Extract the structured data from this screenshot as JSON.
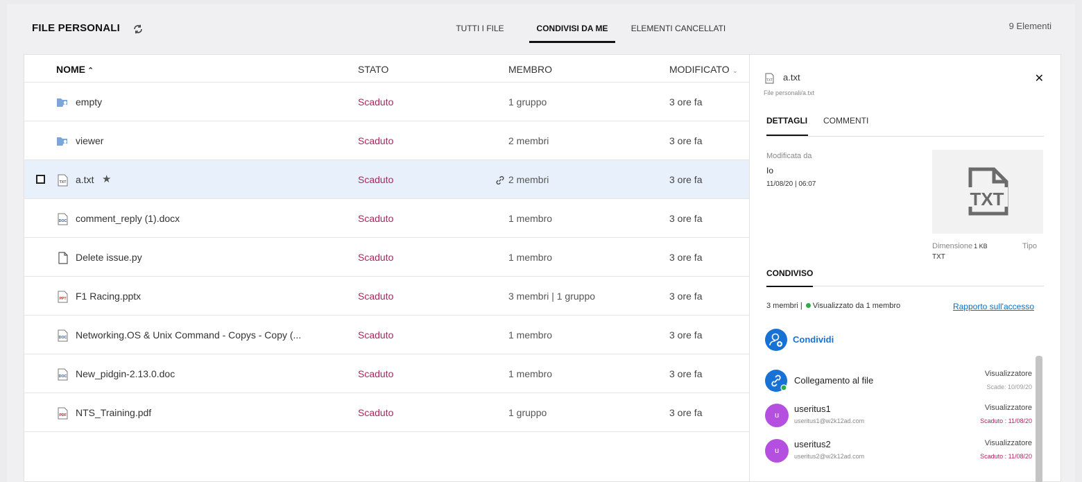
{
  "header": {
    "title": "FILE PERSONALI",
    "tabs": [
      "TUTTI I FILE",
      "CONDIVISI DA ME",
      "ELEMENTI CANCELLATI"
    ],
    "active_tab": "CONDIVISI DA ME",
    "count": "9 Elementi"
  },
  "table": {
    "columns": {
      "nome": "NOME",
      "stato": "STATO",
      "membro": "MEMBRO",
      "modificato": "MODIFICATO"
    },
    "rows": [
      {
        "icon": "shared-folder-icon",
        "name": "empty",
        "stato": "Scaduto",
        "membro": "1 gruppo",
        "modificato": "3 ore fa"
      },
      {
        "icon": "shared-folder-icon",
        "name": "viewer",
        "stato": "Scaduto",
        "membro": "2 membri",
        "modificato": "3 ore fa"
      },
      {
        "icon": "txt-file-icon",
        "name": "a.txt",
        "stato": "Scaduto",
        "membro": "2 membri",
        "modificato": "3 ore fa",
        "selected": true
      },
      {
        "icon": "doc-file-icon",
        "name": "comment_reply (1).docx",
        "stato": "Scaduto",
        "membro": "1 membro",
        "modificato": "3 ore fa"
      },
      {
        "icon": "generic-file-icon",
        "name": "Delete issue.py",
        "stato": "Scaduto",
        "membro": "1 membro",
        "modificato": "3 ore fa"
      },
      {
        "icon": "ppt-file-icon",
        "name": "F1 Racing.pptx",
        "stato": "Scaduto",
        "membro": "3 membri | 1 gruppo",
        "modificato": "3 ore fa"
      },
      {
        "icon": "doc-file-icon",
        "name": "Networking.OS & Unix Command - Copys - Copy (...",
        "stato": "Scaduto",
        "membro": "1 membro",
        "modificato": "3 ore fa"
      },
      {
        "icon": "doc-file-icon",
        "name": "New_pidgin-2.13.0.doc",
        "stato": "Scaduto",
        "membro": "1 membro",
        "modificato": "3 ore fa"
      },
      {
        "icon": "pdf-file-icon",
        "name": "NTS_Training.pdf",
        "stato": "Scaduto",
        "membro": "1 gruppo",
        "modificato": "3 ore fa"
      }
    ]
  },
  "details": {
    "file_name": "a.txt",
    "path": "File personali/a.txt",
    "tabs": [
      "DETTAGLI",
      "COMMENTI"
    ],
    "modified_label": "Modificata da",
    "modified_by": "Io",
    "modified_date": "11/08/20 | 06:07",
    "size_label": "Dimensione",
    "size_value": "1 KB",
    "type_label": "Tipo",
    "type_value": "TXT",
    "preview_text": "TXT",
    "shared_heading": "CONDIVISO",
    "share_members": "3 membri",
    "share_viewed": "Visualizzato da 1 membro",
    "access_report": "Rapporto sull'accesso",
    "share_button": "Condividi",
    "icon_text_badge": "TXT",
    "icon_text_doc": "DOC",
    "icon_text_ppt": "PPT",
    "icon_text_pdf": "PDF",
    "entries": [
      {
        "name": "Collegamento al file",
        "email": "",
        "role": "Visualizzatore",
        "expiry": "Scade: 10/09/20",
        "expired": false,
        "avatar": ""
      },
      {
        "name": "useritus1",
        "email": "useritus1@w2k12ad.com",
        "role": "Visualizzatore",
        "expiry": "Scaduto : 11/08/20",
        "expired": true,
        "avatar": "u"
      },
      {
        "name": "useritus2",
        "email": "useritus2@w2k12ad.com",
        "role": "Visualizzatore",
        "expiry": "Scaduto : 11/08/20",
        "expired": true,
        "avatar": "u"
      }
    ]
  },
  "colors": {
    "expired": "#b4215c",
    "accent": "#1872d6",
    "avatar": "#b44fe0",
    "online": "#2eaa4a",
    "selected_row": "#e8f1fb"
  }
}
